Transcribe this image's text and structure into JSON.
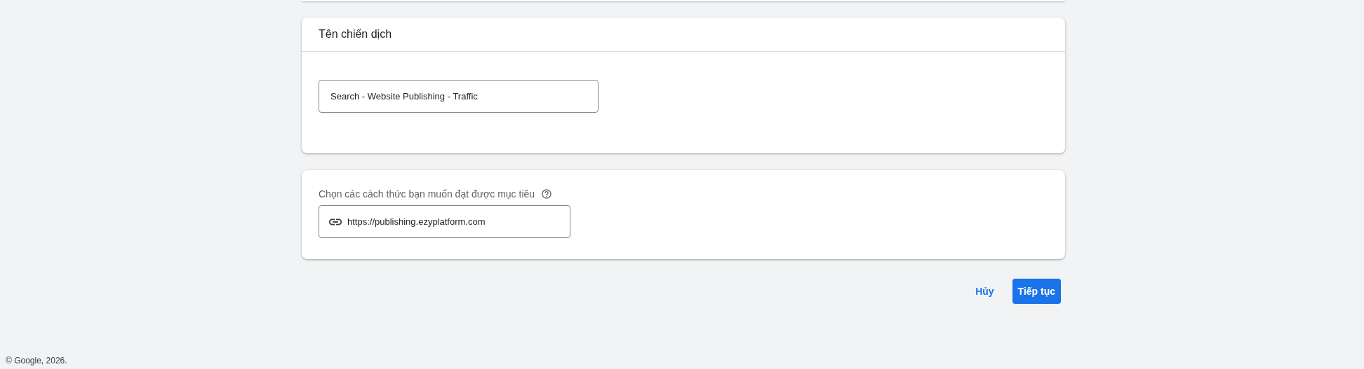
{
  "campaign_name_card": {
    "title": "Tên chiến dịch",
    "field": {
      "value": "Search - Website Publishing - Traffic"
    }
  },
  "goal_card": {
    "label": "Chọn các cách thức bạn muốn đạt được mục tiêu",
    "url_field": {
      "value": "https://publishing.ezyplatform.com"
    }
  },
  "actions": {
    "cancel": "Hủy",
    "continue": "Tiếp tục"
  },
  "footer": "© Google, 2026."
}
